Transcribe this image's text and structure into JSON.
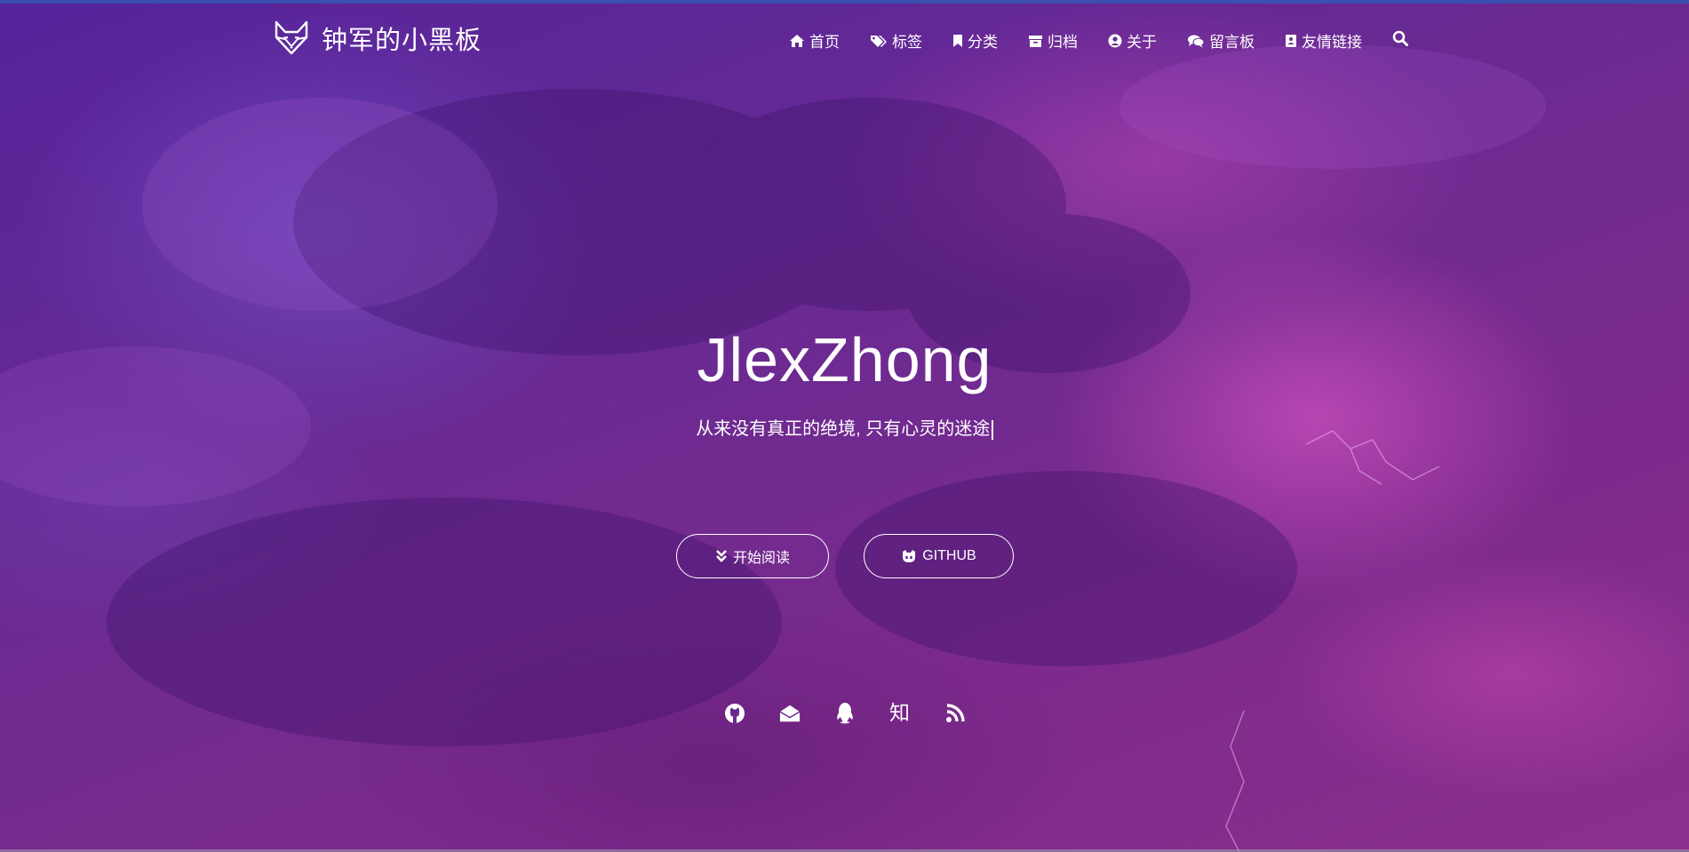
{
  "site": {
    "brand_name": "钟军的小黑板",
    "logo_icon": "fox-icon"
  },
  "nav": {
    "items": [
      {
        "label": "首页",
        "icon": "home-icon"
      },
      {
        "label": "标签",
        "icon": "tags-icon"
      },
      {
        "label": "分类",
        "icon": "bookmark-icon"
      },
      {
        "label": "归档",
        "icon": "archive-icon"
      },
      {
        "label": "关于",
        "icon": "user-circle-icon"
      },
      {
        "label": "留言板",
        "icon": "comments-icon"
      },
      {
        "label": "友情链接",
        "icon": "address-book-icon"
      }
    ],
    "search_icon": "search-icon"
  },
  "hero": {
    "title": "JlexZhong",
    "subtitle": "从来没有真正的绝境, 只有心灵的迷途",
    "buttons": {
      "read_label": "开始阅读",
      "github_label": "GITHUB"
    }
  },
  "socials": {
    "zhihu_label": "知",
    "items": [
      "github-icon",
      "mail-icon",
      "qq-icon",
      "zhihu-icon",
      "rss-icon"
    ]
  },
  "colors": {
    "accent": "#5a2a9c",
    "text": "#ffffff",
    "top_bar": "#3a4fb0"
  }
}
